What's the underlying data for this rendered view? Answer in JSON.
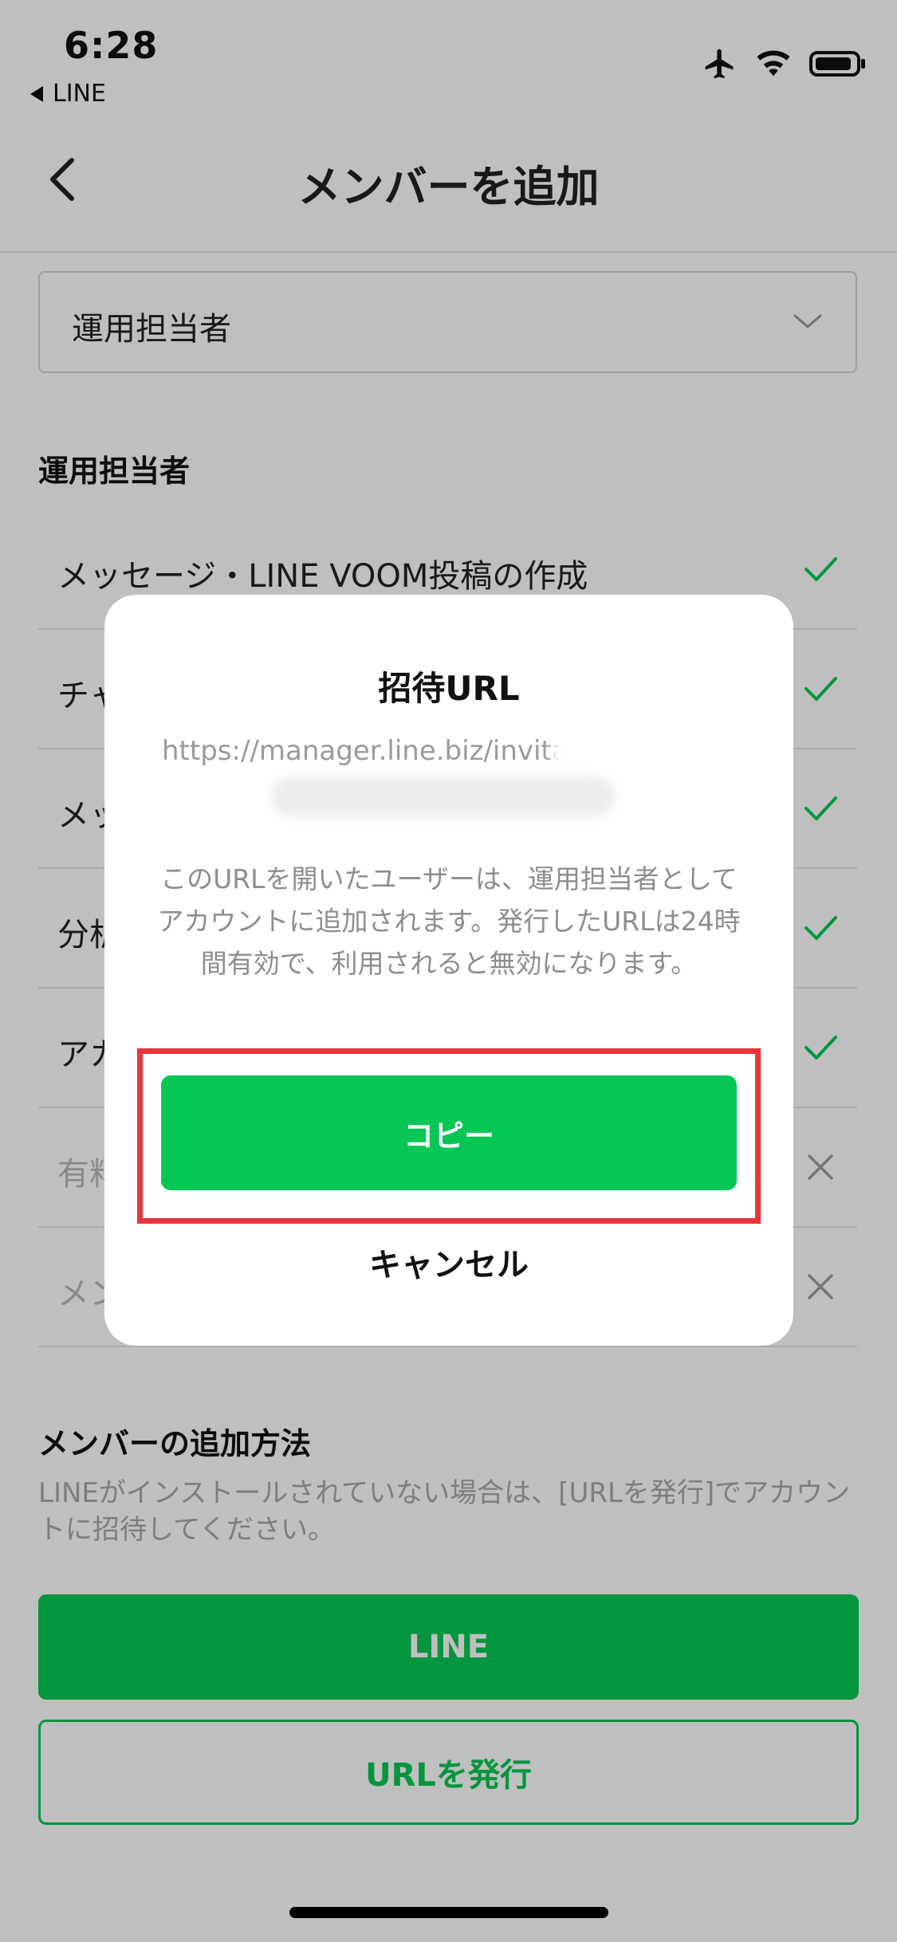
{
  "status_bar": {
    "time": "6:28",
    "back_app": "LINE"
  },
  "nav": {
    "title": "メンバーを追加"
  },
  "role_select": {
    "value": "運用担当者"
  },
  "permissions": {
    "heading": "運用担当者",
    "items": [
      {
        "label": "メッセージ・LINE VOOM投稿の作成",
        "enabled": true
      },
      {
        "label": "チャ",
        "enabled": true
      },
      {
        "label": "メッ",
        "enabled": true
      },
      {
        "label": "分析",
        "enabled": true
      },
      {
        "label": "アカ",
        "enabled": true
      },
      {
        "label": "有料",
        "enabled": false
      },
      {
        "label": "メン",
        "enabled": false
      }
    ]
  },
  "add_method": {
    "heading": "メンバーの追加方法",
    "helper": "LINEがインストールされていない場合は、[URLを発行]でアカウントに招待してください。",
    "line_button": "LINE",
    "url_button": "URLを発行"
  },
  "dialog": {
    "title": "招待URL",
    "url": "https://manager.line.biz/invitation",
    "description": "このURLを開いたユーザーは、運用担当者としてアカウントに追加されます。発行したURLは24時間有効で、利用されると無効になります。",
    "copy_button": "コピー",
    "cancel_button": "キャンセル"
  },
  "colors": {
    "accent": "#06c755",
    "highlight": "#e8363b"
  }
}
